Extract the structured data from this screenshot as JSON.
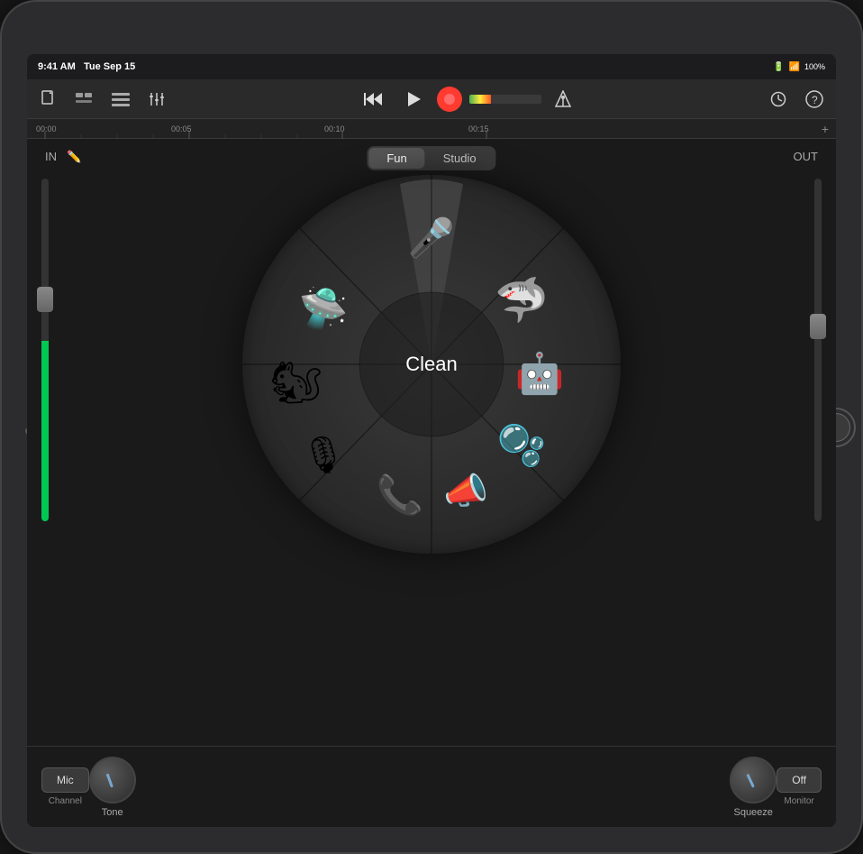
{
  "status_bar": {
    "time": "9:41 AM",
    "date": "Tue Sep 15",
    "battery": "100%"
  },
  "toolbar": {
    "new_song_label": "📄",
    "tracks_label": "⊞",
    "list_label": "☰",
    "mixer_label": "🎚",
    "rewind_label": "⏮",
    "play_label": "▶",
    "tempo_label": "⏱",
    "help_label": "?"
  },
  "timeline": {
    "markers": [
      "00:00",
      "00:05",
      "00:10",
      "00:15"
    ]
  },
  "mode_toggle": {
    "fun_label": "Fun",
    "studio_label": "Studio",
    "active": "fun"
  },
  "labels": {
    "in": "IN",
    "out": "OUT",
    "center": "Clean"
  },
  "effects": [
    {
      "id": "microphone",
      "emoji": "🎤",
      "angle": 90,
      "radius": 140,
      "label": "Microphone"
    },
    {
      "id": "alien",
      "emoji": "🛸",
      "angle": 150,
      "radius": 155,
      "label": "Alien"
    },
    {
      "id": "monster",
      "emoji": "🦈",
      "angle": 30,
      "radius": 155,
      "label": "Monster"
    },
    {
      "id": "squirrel",
      "emoji": "🐿",
      "angle": 200,
      "radius": 155,
      "label": "Squirrel"
    },
    {
      "id": "robot",
      "emoji": "🤖",
      "angle": 340,
      "radius": 155,
      "label": "Robot"
    },
    {
      "id": "microphone2",
      "emoji": "🎙",
      "angle": 245,
      "radius": 150,
      "label": "Stage Mic"
    },
    {
      "id": "bubbles",
      "emoji": "🫧",
      "angle": 300,
      "radius": 155,
      "label": "Bubbles"
    },
    {
      "id": "telephone",
      "emoji": "📞",
      "angle": 265,
      "radius": 90,
      "label": "Telephone"
    },
    {
      "id": "megaphone",
      "emoji": "📣",
      "angle": 285,
      "radius": 90,
      "label": "Megaphone"
    }
  ],
  "bottom_controls": {
    "mic_channel_label": "Mic",
    "mic_channel_sub": "Channel",
    "tone_label": "Tone",
    "squeeze_label": "Squeeze",
    "monitor_label": "Off",
    "monitor_sub": "Monitor"
  }
}
